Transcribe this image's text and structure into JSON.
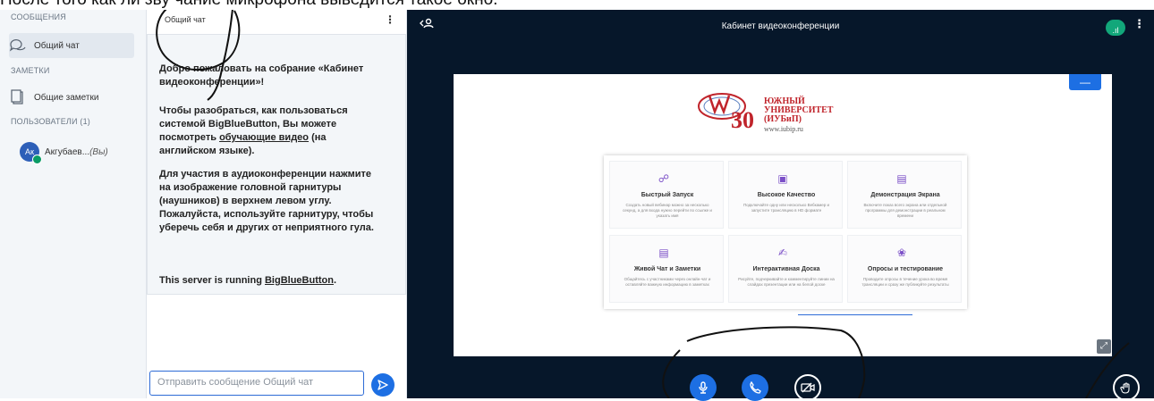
{
  "caption": {
    "text": "После того как ли зву чание микрофона выведится такое окно."
  },
  "sidebar": {
    "messages_heading": "СООБЩЕНИЯ",
    "public_chat_label": "Общий чат",
    "notes_heading": "ЗАМЕТКИ",
    "shared_notes_label": "Общие заметки",
    "users_heading": "ПОЛЬЗОВАТЕЛИ (1)",
    "user": {
      "initials": "Ак",
      "name": "Акгубаев...",
      "you": "(Вы)"
    }
  },
  "chat": {
    "title": "Общий чат",
    "welcome": {
      "p1_a": "Добро пожаловать на собрание «",
      "p1_b": "Кабинет видеоконференции",
      "p1_c": "»!",
      "p2_a": "Чтобы разобраться, как пользоваться системой BigBlueButton, Вы можете посмотреть ",
      "p2_link": "обучающие видео",
      "p2_b": " (на английском языке).",
      "p3_a": "Для участия в аудиоконференции нажмите на изображение головной гарнитуры (наушников) в верхнем левом углу. ",
      "p3_b": "Пожалуйста, используйте гарнитуру, чтобы уберечь себя и других от неприятного гула.",
      "p4_a": "This server is running ",
      "p4_link": "BigBlueButton",
      "p4_b": "."
    },
    "input_placeholder": "Отправить сообщение Общий чат"
  },
  "stage": {
    "title": "Кабинет видеоконференции",
    "signal_label": ".ıl",
    "slide": {
      "university": [
        "ЮЖНЫЙ",
        "УНИВЕРСИТЕТ",
        "(ИУБиП)"
      ],
      "url": "www.iubip.ru",
      "features": [
        {
          "title": "Быстрый Запуск",
          "icon": "share-icon",
          "desc": "Создать новый вебинар можно за несколько секунд, а для входа нужно перейти по ссылке и указать имя"
        },
        {
          "title": "Высокое Качество",
          "icon": "hd-icon",
          "desc": "Подключайте одну или несколько Вебкамер и запустите трансляцию в HD формате"
        },
        {
          "title": "Демонстрация Экрана",
          "icon": "screen-icon",
          "desc": "Включите показ всего экрана или отдельной программы для демонстрации в реальном времени"
        },
        {
          "title": "Живой Чат и Заметки",
          "icon": "chat-icon",
          "desc": "Общайтесь с участниками через онлайн-чат и оставляйте важную информацию в заметках"
        },
        {
          "title": "Интерактивная Доска",
          "icon": "whiteboard-icon",
          "desc": "Рисуйте, подчеркивайте и комментируйте линии на слайдах презентации или на белой доске"
        },
        {
          "title": "Опросы и тестирование",
          "icon": "award-icon",
          "desc": "Проводите опросы в течение урока во время трансляции и сразу же публикуйте результаты"
        }
      ]
    }
  }
}
